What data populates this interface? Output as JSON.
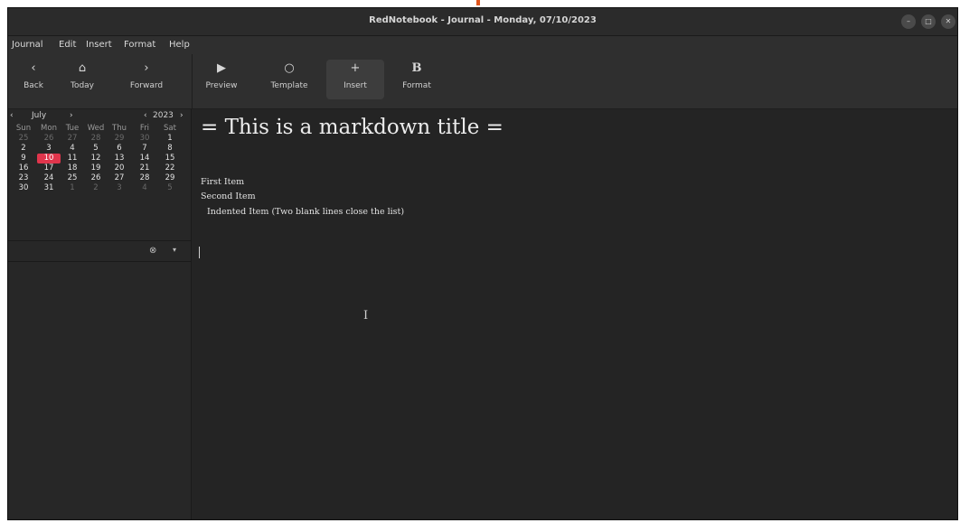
{
  "window": {
    "title": "RedNotebook - Journal - Monday, 07/10/2023"
  },
  "menubar": {
    "items": [
      "Journal",
      "Edit",
      "Insert",
      "Format",
      "Help"
    ]
  },
  "toolbar": {
    "back_label": "Back",
    "today_label": "Today",
    "forward_label": "Forward",
    "preview_label": "Preview",
    "template_label": "Template",
    "insert_label": "Insert",
    "format_label": "Format"
  },
  "calendar": {
    "month": "July",
    "year": "2023",
    "day_names": [
      "Sun",
      "Mon",
      "Tue",
      "Wed",
      "Thu",
      "Fri",
      "Sat"
    ],
    "weeks": [
      [
        "25",
        "26",
        "27",
        "28",
        "29",
        "30",
        "1"
      ],
      [
        "2",
        "3",
        "4",
        "5",
        "6",
        "7",
        "8"
      ],
      [
        "9",
        "10",
        "11",
        "12",
        "13",
        "14",
        "15"
      ],
      [
        "16",
        "17",
        "18",
        "19",
        "20",
        "21",
        "22"
      ],
      [
        "23",
        "24",
        "25",
        "26",
        "27",
        "28",
        "29"
      ],
      [
        "30",
        "31",
        "1",
        "2",
        "3",
        "4",
        "5"
      ]
    ],
    "selected_day": "10"
  },
  "editor": {
    "title": "= This is a markdown title =",
    "items": [
      "First Item",
      "Second Item"
    ],
    "indented_item": "Indented Item (Two blank lines close the list)"
  },
  "colors": {
    "accent": "#e0354c",
    "window_bg": "#242424"
  }
}
